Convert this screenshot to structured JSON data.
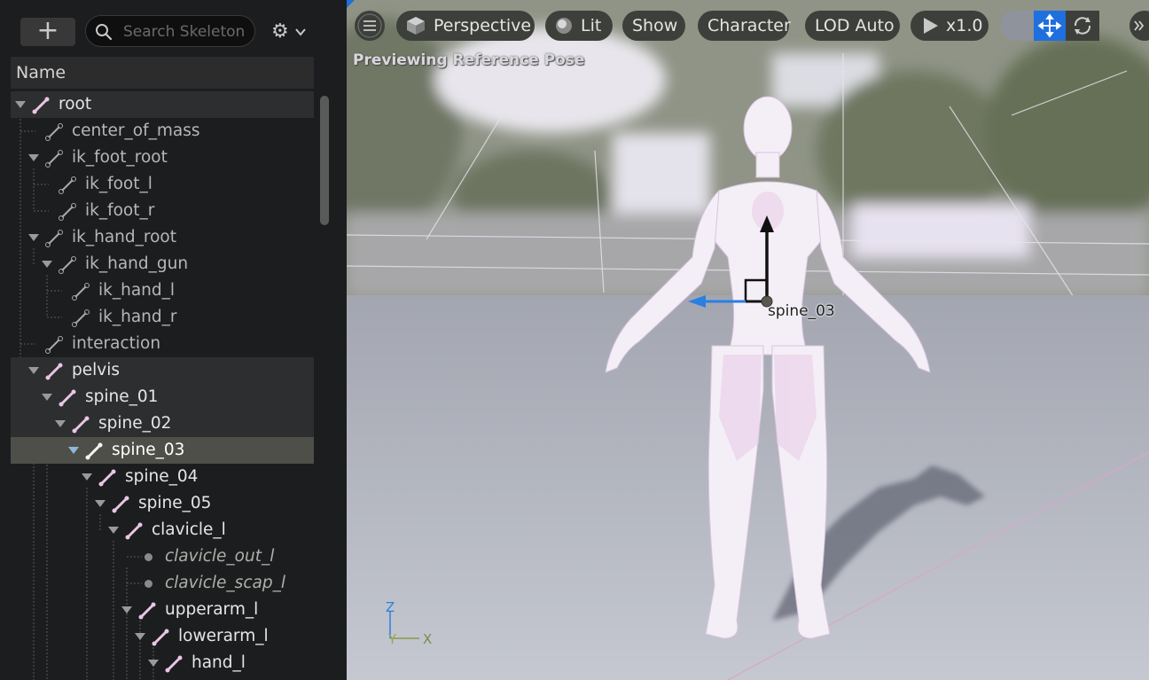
{
  "outliner": {
    "search_placeholder": "Search Skeleton",
    "column_header": "Name",
    "rows": [
      {
        "label": "root"
      },
      {
        "label": "center_of_mass"
      },
      {
        "label": "ik_foot_root"
      },
      {
        "label": "ik_foot_l"
      },
      {
        "label": "ik_foot_r"
      },
      {
        "label": "ik_hand_root"
      },
      {
        "label": "ik_hand_gun"
      },
      {
        "label": "ik_hand_l"
      },
      {
        "label": "ik_hand_r"
      },
      {
        "label": "interaction"
      },
      {
        "label": "pelvis"
      },
      {
        "label": "spine_01"
      },
      {
        "label": "spine_02"
      },
      {
        "label": "spine_03"
      },
      {
        "label": "spine_04"
      },
      {
        "label": "spine_05"
      },
      {
        "label": "clavicle_l"
      },
      {
        "label": "clavicle_out_l"
      },
      {
        "label": "clavicle_scap_l"
      },
      {
        "label": "upperarm_l"
      },
      {
        "label": "lowerarm_l"
      },
      {
        "label": "hand_l"
      }
    ]
  },
  "viewport": {
    "toolbar": {
      "perspective": "Perspective",
      "lit": "Lit",
      "show": "Show",
      "character": "Character",
      "lod": "LOD Auto",
      "play_speed": "x1.0"
    },
    "status_text": "Previewing Reference Pose",
    "selected_bone_label": "spine_03",
    "axis_labels": {
      "z": "Z",
      "y": "Y",
      "x": "X"
    }
  },
  "colors": {
    "accent_blue": "#1f6fde",
    "bone_icon": "#e9c6e4",
    "selection": "#4f4f4a"
  }
}
